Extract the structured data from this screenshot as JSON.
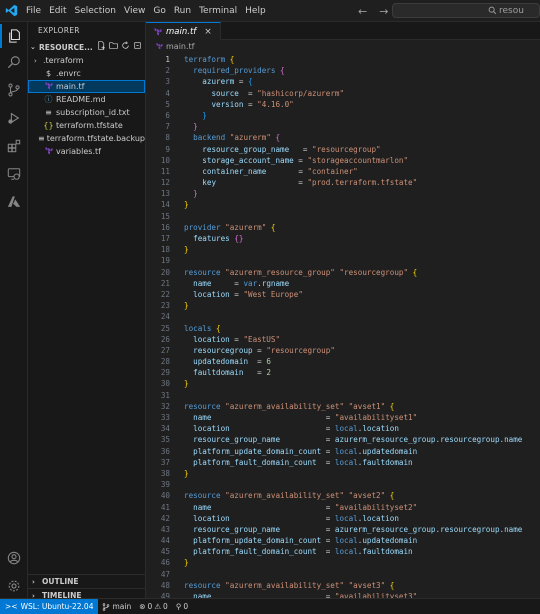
{
  "menu": [
    "File",
    "Edit",
    "Selection",
    "View",
    "Go",
    "Run",
    "Terminal",
    "Help"
  ],
  "search": {
    "text": "resou"
  },
  "icons": {
    "logo": "vscode-logo-icon",
    "back": "arrow-left-icon",
    "forward": "arrow-right-icon",
    "explorer": "files-icon",
    "search": "search-icon",
    "scm": "source-control-icon",
    "debug": "run-debug-icon",
    "extensions": "extensions-icon",
    "remote": "remote-explorer-icon",
    "azure": "azure-icon",
    "account": "account-icon",
    "settings": "gear-icon"
  },
  "sidebar": {
    "title": "EXPLORER",
    "root": "RESOURCE...",
    "items": [
      {
        "label": ".terraform",
        "kind": "folder"
      },
      {
        "label": ".envrc",
        "kind": "file",
        "icon": "$"
      },
      {
        "label": "main.tf",
        "kind": "tf",
        "selected": true
      },
      {
        "label": "README.md",
        "kind": "md"
      },
      {
        "label": "subscription_id.txt",
        "kind": "txt"
      },
      {
        "label": "terraform.tfstate",
        "kind": "json"
      },
      {
        "label": "terraform.tfstate.backup",
        "kind": "file"
      },
      {
        "label": "variables.tf",
        "kind": "tf"
      }
    ],
    "outline": "OUTLINE",
    "timeline": "TIMELINE"
  },
  "editor": {
    "tab_label": "main.tf",
    "breadcrumb": "main.tf",
    "lines": [
      [
        [
          "kw",
          "terraform"
        ],
        [
          "id",
          " "
        ],
        [
          "br1",
          "{"
        ]
      ],
      [
        [
          "id",
          "  "
        ],
        [
          "kw",
          "required_providers"
        ],
        [
          "id",
          " "
        ],
        [
          "br2",
          "{"
        ]
      ],
      [
        [
          "id",
          "    "
        ],
        [
          "var",
          "azurerm"
        ],
        [
          "id",
          " = "
        ],
        [
          "br3",
          "{"
        ]
      ],
      [
        [
          "id",
          "      "
        ],
        [
          "var",
          "source"
        ],
        [
          "id",
          "  = "
        ],
        [
          "str",
          "\"hashicorp/azurerm\""
        ]
      ],
      [
        [
          "id",
          "      "
        ],
        [
          "var",
          "version"
        ],
        [
          "id",
          " = "
        ],
        [
          "str",
          "\"4.16.0\""
        ]
      ],
      [
        [
          "id",
          "    "
        ],
        [
          "br3",
          "}"
        ]
      ],
      [
        [
          "id",
          "  "
        ],
        [
          "br2",
          "}"
        ]
      ],
      [
        [
          "id",
          "  "
        ],
        [
          "kw",
          "backend"
        ],
        [
          "id",
          " "
        ],
        [
          "str",
          "\"azurerm\""
        ],
        [
          "id",
          " "
        ],
        [
          "br2",
          "{"
        ]
      ],
      [
        [
          "id",
          "    "
        ],
        [
          "var",
          "resource_group_name"
        ],
        [
          "id",
          "   = "
        ],
        [
          "str",
          "\"resourcegroup\""
        ]
      ],
      [
        [
          "id",
          "    "
        ],
        [
          "var",
          "storage_account_name"
        ],
        [
          "id",
          " = "
        ],
        [
          "str",
          "\"storageaccountmarlon\""
        ]
      ],
      [
        [
          "id",
          "    "
        ],
        [
          "var",
          "container_name"
        ],
        [
          "id",
          "       = "
        ],
        [
          "str",
          "\"container\""
        ]
      ],
      [
        [
          "id",
          "    "
        ],
        [
          "var",
          "key"
        ],
        [
          "id",
          "                  = "
        ],
        [
          "str",
          "\"prod.terraform.tfstate\""
        ]
      ],
      [
        [
          "id",
          "  "
        ],
        [
          "br2",
          "}"
        ]
      ],
      [
        [
          "br1",
          "}"
        ]
      ],
      [],
      [
        [
          "kw",
          "provider"
        ],
        [
          "id",
          " "
        ],
        [
          "str",
          "\"azurerm\""
        ],
        [
          "id",
          " "
        ],
        [
          "br1",
          "{"
        ]
      ],
      [
        [
          "id",
          "  "
        ],
        [
          "var",
          "features"
        ],
        [
          "id",
          " "
        ],
        [
          "br2",
          "{}"
        ]
      ],
      [
        [
          "br1",
          "}"
        ]
      ],
      [],
      [
        [
          "kw",
          "resource"
        ],
        [
          "id",
          " "
        ],
        [
          "str",
          "\"azurerm_resource_group\""
        ],
        [
          "id",
          " "
        ],
        [
          "str",
          "\"resourcegroup\""
        ],
        [
          "id",
          " "
        ],
        [
          "br1",
          "{"
        ]
      ],
      [
        [
          "id",
          "  "
        ],
        [
          "var",
          "name"
        ],
        [
          "id",
          "     = "
        ],
        [
          "kw",
          "var"
        ],
        [
          "id",
          "."
        ],
        [
          "var",
          "rgname"
        ]
      ],
      [
        [
          "id",
          "  "
        ],
        [
          "var",
          "location"
        ],
        [
          "id",
          " = "
        ],
        [
          "str",
          "\"West Europe\""
        ]
      ],
      [
        [
          "br1",
          "}"
        ]
      ],
      [],
      [
        [
          "kw",
          "locals"
        ],
        [
          "id",
          " "
        ],
        [
          "br1",
          "{"
        ]
      ],
      [
        [
          "id",
          "  "
        ],
        [
          "var",
          "location"
        ],
        [
          "id",
          " = "
        ],
        [
          "str",
          "\"EastUS\""
        ]
      ],
      [
        [
          "id",
          "  "
        ],
        [
          "var",
          "resourcegroup"
        ],
        [
          "id",
          " = "
        ],
        [
          "str",
          "\"resourcegroup\""
        ]
      ],
      [
        [
          "id",
          "  "
        ],
        [
          "var",
          "updatedomain"
        ],
        [
          "id",
          "  = "
        ],
        [
          "num",
          "6"
        ]
      ],
      [
        [
          "id",
          "  "
        ],
        [
          "var",
          "faultdomain"
        ],
        [
          "id",
          "   = "
        ],
        [
          "num",
          "2"
        ]
      ],
      [
        [
          "br1",
          "}"
        ]
      ],
      [],
      [
        [
          "kw",
          "resource"
        ],
        [
          "id",
          " "
        ],
        [
          "str",
          "\"azurerm_availability_set\""
        ],
        [
          "id",
          " "
        ],
        [
          "str",
          "\"avset1\""
        ],
        [
          "id",
          " "
        ],
        [
          "br1",
          "{"
        ]
      ],
      [
        [
          "id",
          "  "
        ],
        [
          "var",
          "name"
        ],
        [
          "id",
          "                         = "
        ],
        [
          "str",
          "\"availabilityset1\""
        ]
      ],
      [
        [
          "id",
          "  "
        ],
        [
          "var",
          "location"
        ],
        [
          "id",
          "                     = "
        ],
        [
          "kw",
          "local"
        ],
        [
          "id",
          "."
        ],
        [
          "var",
          "location"
        ]
      ],
      [
        [
          "id",
          "  "
        ],
        [
          "var",
          "resource_group_name"
        ],
        [
          "id",
          "          = "
        ],
        [
          "var",
          "azurerm_resource_group"
        ],
        [
          "id",
          "."
        ],
        [
          "var",
          "resourcegroup"
        ],
        [
          "id",
          "."
        ],
        [
          "var",
          "name"
        ]
      ],
      [
        [
          "id",
          "  "
        ],
        [
          "var",
          "platform_update_domain_count"
        ],
        [
          "id",
          " = "
        ],
        [
          "kw",
          "local"
        ],
        [
          "id",
          "."
        ],
        [
          "var",
          "updatedomain"
        ]
      ],
      [
        [
          "id",
          "  "
        ],
        [
          "var",
          "platform_fault_domain_count"
        ],
        [
          "id",
          "  = "
        ],
        [
          "kw",
          "local"
        ],
        [
          "id",
          "."
        ],
        [
          "var",
          "faultdomain"
        ]
      ],
      [
        [
          "br1",
          "}"
        ]
      ],
      [],
      [
        [
          "kw",
          "resource"
        ],
        [
          "id",
          " "
        ],
        [
          "str",
          "\"azurerm_availability_set\""
        ],
        [
          "id",
          " "
        ],
        [
          "str",
          "\"avset2\""
        ],
        [
          "id",
          " "
        ],
        [
          "br1",
          "{"
        ]
      ],
      [
        [
          "id",
          "  "
        ],
        [
          "var",
          "name"
        ],
        [
          "id",
          "                         = "
        ],
        [
          "str",
          "\"availabilityset2\""
        ]
      ],
      [
        [
          "id",
          "  "
        ],
        [
          "var",
          "location"
        ],
        [
          "id",
          "                     = "
        ],
        [
          "kw",
          "local"
        ],
        [
          "id",
          "."
        ],
        [
          "var",
          "location"
        ]
      ],
      [
        [
          "id",
          "  "
        ],
        [
          "var",
          "resource_group_name"
        ],
        [
          "id",
          "          = "
        ],
        [
          "var",
          "azurerm_resource_group"
        ],
        [
          "id",
          "."
        ],
        [
          "var",
          "resourcegroup"
        ],
        [
          "id",
          "."
        ],
        [
          "var",
          "name"
        ]
      ],
      [
        [
          "id",
          "  "
        ],
        [
          "var",
          "platform_update_domain_count"
        ],
        [
          "id",
          " = "
        ],
        [
          "kw",
          "local"
        ],
        [
          "id",
          "."
        ],
        [
          "var",
          "updatedomain"
        ]
      ],
      [
        [
          "id",
          "  "
        ],
        [
          "var",
          "platform_fault_domain_count"
        ],
        [
          "id",
          "  = "
        ],
        [
          "kw",
          "local"
        ],
        [
          "id",
          "."
        ],
        [
          "var",
          "faultdomain"
        ]
      ],
      [
        [
          "br1",
          "}"
        ]
      ],
      [],
      [
        [
          "kw",
          "resource"
        ],
        [
          "id",
          " "
        ],
        [
          "str",
          "\"azurerm_availability_set\""
        ],
        [
          "id",
          " "
        ],
        [
          "str",
          "\"avset3\""
        ],
        [
          "id",
          " "
        ],
        [
          "br1",
          "{"
        ]
      ],
      [
        [
          "id",
          "  "
        ],
        [
          "var",
          "name"
        ],
        [
          "id",
          "                         = "
        ],
        [
          "str",
          "\"availabilityset3\""
        ]
      ]
    ]
  },
  "status": {
    "remote": "WSL: Ubuntu-22.04",
    "branch": "main",
    "errors": "0",
    "warnings": "0",
    "ports": "0"
  },
  "colors": {
    "accent": "#0078d4",
    "keyword": "#569cd6",
    "string": "#ce9178",
    "variable": "#9cdcfe"
  }
}
